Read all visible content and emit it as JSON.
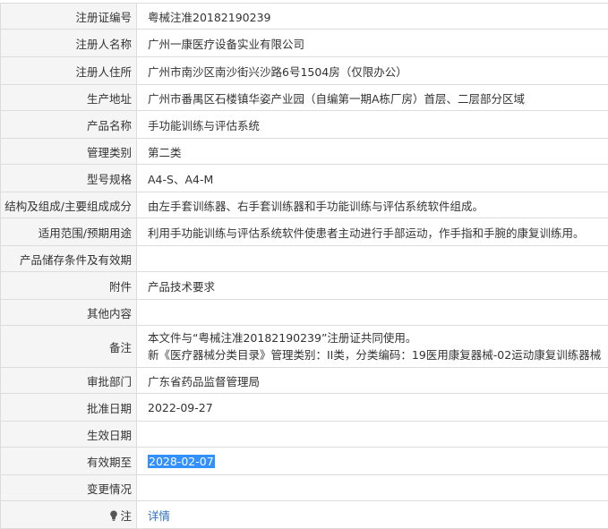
{
  "rows": [
    {
      "label": "注册证编号",
      "value": "粤械注准20182190239"
    },
    {
      "label": "注册人名称",
      "value": "广州一康医疗设备实业有限公司"
    },
    {
      "label": "注册人住所",
      "value": "广州市南沙区南沙街兴沙路6号1504房（仅限办公）"
    },
    {
      "label": "生产地址",
      "value": "广州市番禺区石楼镇华姿产业园（自编第一期A栋厂房）首层、二层部分区域"
    },
    {
      "label": "产品名称",
      "value": "手功能训练与评估系统"
    },
    {
      "label": "管理类别",
      "value": "第二类"
    },
    {
      "label": "型号规格",
      "value": "A4-S、A4-M"
    },
    {
      "label": "结构及组成/主要组成成分",
      "value": "由左手套训练器、右手套训练器和手功能训练与评估系统软件组成。"
    },
    {
      "label": "适用范围/预期用途",
      "value": "利用手功能训练与评估系统软件使患者主动进行手部运动，作手指和手腕的康复训练用。"
    },
    {
      "label": "产品储存条件及有效期",
      "value": ""
    },
    {
      "label": "附件",
      "value": "产品技术要求"
    },
    {
      "label": "其他内容",
      "value": ""
    },
    {
      "label": "备注",
      "lines": [
        "本文件与“粤械注准20182190239”注册证共同使用。",
        "新《医疗器械分类目录》管理类别：II类，分类编码：19医用康复器械-02运动康复训练器械"
      ]
    },
    {
      "label": "审批部门",
      "value": "广东省药品监督管理局"
    },
    {
      "label": "批准日期",
      "value": "2022-09-27"
    },
    {
      "label": "生效日期",
      "value": ""
    },
    {
      "label": "有效期至",
      "value": "2028-02-07"
    },
    {
      "label": "变更情况",
      "value": ""
    },
    {
      "label": "注",
      "value": "详情"
    }
  ],
  "icons": {
    "note_icon": "lightbulb-icon"
  },
  "colors": {
    "highlight": "#3390ff",
    "link": "#2f6fbf",
    "label_bg": "#f5f5f5",
    "border": "#dcdcdc"
  }
}
